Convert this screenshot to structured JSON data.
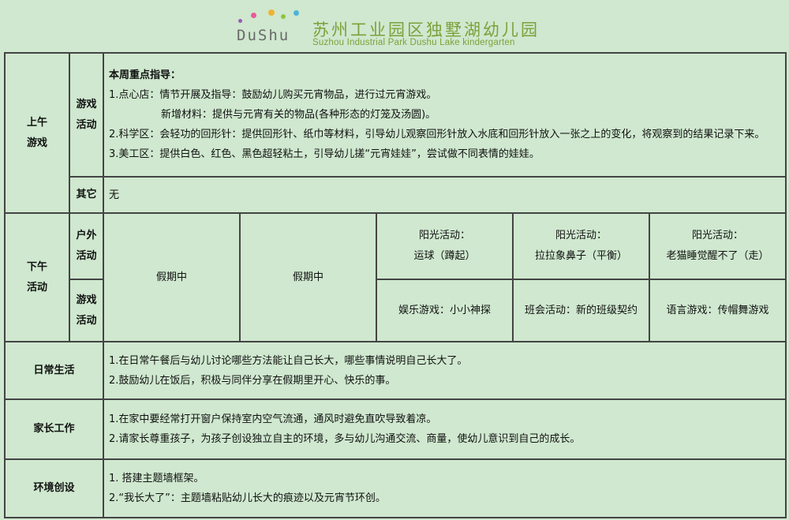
{
  "header": {
    "logo_text": "DuShu",
    "title_cn": "苏州工业园区独墅湖幼儿园",
    "title_en": "Suzhou Industrial Park Dushu Lake kindergarten"
  },
  "morning": {
    "label_line1": "上午",
    "label_line2": "游戏",
    "game_label_line1": "游戏",
    "game_label_line2": "活动",
    "focus_title": "本周重点指导：",
    "items": [
      "1.点心店：情节开展及指导：鼓励幼儿购买元宵物品，进行过元宵游戏。",
      "新增材料：提供与元宵有关的物品(各种形态的灯笼及汤圆)。",
      "2.科学区：会轻功的回形针：提供回形针、纸巾等材料，引导幼儿观察回形针放入水底和回形针放入一张之上的变化，将观察到的结果记录下来。",
      "3.美工区：提供白色、红色、黑色超轻粘土，引导幼儿搓“元宵娃娃”，尝试做不同表情的娃娃。"
    ],
    "other_label": "其它",
    "other_value": "无"
  },
  "afternoon": {
    "label_line1": "下午",
    "label_line2": "活动",
    "outdoor_label_line1": "户外",
    "outdoor_label_line2": "活动",
    "game_label_line1": "游戏",
    "game_label_line2": "活动",
    "holiday": [
      "假期中",
      "假期中"
    ],
    "outdoor": [
      {
        "line1": "阳光活动：",
        "line2": "运球（蹲起）"
      },
      {
        "line1": "阳光活动：",
        "line2": "拉拉象鼻子（平衡）"
      },
      {
        "line1": "阳光活动：",
        "line2": "老猫睡觉醒不了（走）"
      }
    ],
    "games": [
      "娱乐游戏：小小神探",
      "班会活动：新的班级契约",
      "语言游戏：传帽舞游戏"
    ]
  },
  "daily": {
    "label": "日常生活",
    "items": [
      "1.在日常午餐后与幼儿讨论哪些方法能让自己长大，哪些事情说明自己长大了。",
      "2.鼓励幼儿在饭后，积极与同伴分享在假期里开心、快乐的事。"
    ]
  },
  "parents": {
    "label": "家长工作",
    "items": [
      "1.在家中要经常打开窗户保持室内空气流通，通风时避免直吹导致着凉。",
      "2.请家长尊重孩子，为孩子创设独立自主的环境，多与幼儿沟通交流、商量，使幼儿意识到自己的成长。"
    ]
  },
  "environment": {
    "label": "环境创设",
    "items": [
      "1. 搭建主题墙框架。",
      "2.“我长大了”：主题墙粘贴幼儿长大的痕迹以及元宵节环创。"
    ]
  }
}
